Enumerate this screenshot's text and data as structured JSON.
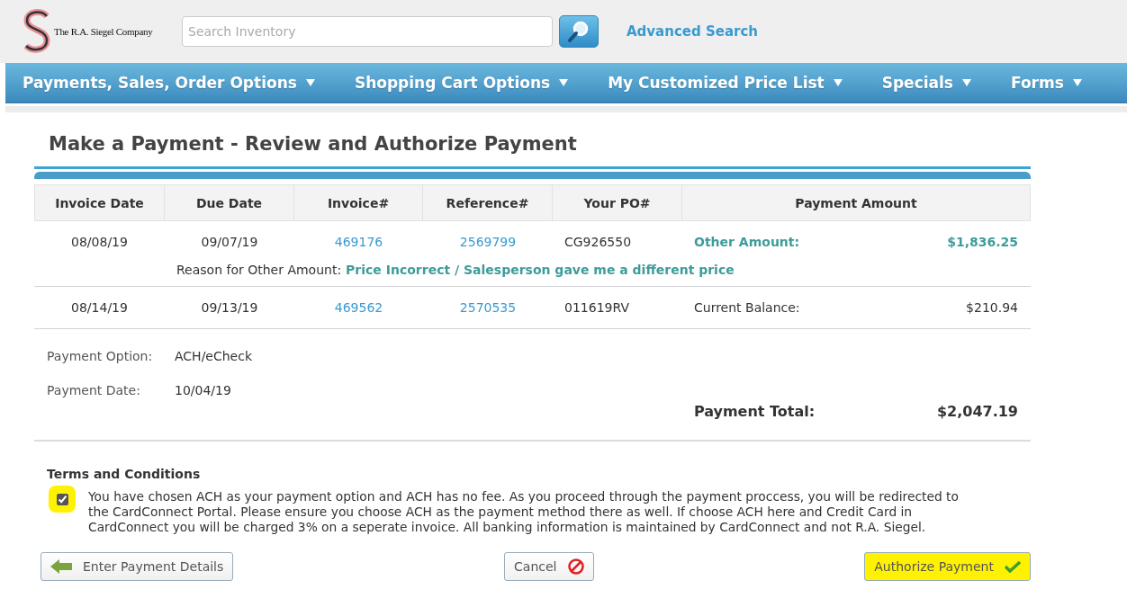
{
  "header": {
    "logo_text": "The R.A. Siegel Company",
    "search": {
      "placeholder": "Search Inventory"
    },
    "advanced_search": "Advanced Search"
  },
  "nav": [
    {
      "label": "Payments, Sales, Order Options"
    },
    {
      "label": "Shopping Cart Options"
    },
    {
      "label": "My Customized Price List"
    },
    {
      "label": "Specials"
    },
    {
      "label": "Forms"
    }
  ],
  "page_title": "Make a Payment - Review and Authorize Payment",
  "table": {
    "columns": [
      "Invoice Date",
      "Due Date",
      "Invoice#",
      "Reference#",
      "Your PO#",
      "Payment Amount"
    ],
    "rows": [
      {
        "invoice_date": "08/08/19",
        "due_date": "09/07/19",
        "invoice": "469176",
        "reference": "2569799",
        "po": "CG926550",
        "kind": "other",
        "amount_label": "Other Amount:",
        "amount": "$1,836.25",
        "reason_label": "Reason for Other Amount:",
        "reason": "Price Incorrect / Salesperson gave me a different price"
      },
      {
        "invoice_date": "08/14/19",
        "due_date": "09/13/19",
        "invoice": "469562",
        "reference": "2570535",
        "po": "011619RV",
        "kind": "balance",
        "amount_label": "Current Balance:",
        "amount": "$210.94"
      }
    ]
  },
  "details": [
    {
      "label": "Payment Option:",
      "value": "ACH/eCheck"
    },
    {
      "label": "Payment Date:",
      "value": "10/04/19"
    }
  ],
  "total": {
    "label": "Payment Total:",
    "value": "$2,047.19"
  },
  "terms": {
    "title": "Terms and Conditions",
    "checked": true,
    "highlighted": true,
    "text": "You have chosen ACH as your payment option and ACH has no fee. As you proceed through the payment proccess, you will be redirected to the CardConnect Portal. Please ensure you choose ACH as the payment method there as well. If choose ACH here and Credit Card in CardConnect you will be charged 3% on a seperate invoice. All banking information is maintained by CardConnect and not R.A. Siegel."
  },
  "buttons": [
    {
      "label": "Enter Payment Details",
      "kind": "back",
      "highlighted": false
    },
    {
      "label": "Cancel",
      "kind": "cancel",
      "highlighted": false
    },
    {
      "label": "Authorize Payment",
      "kind": "authorize",
      "highlighted": true
    }
  ]
}
